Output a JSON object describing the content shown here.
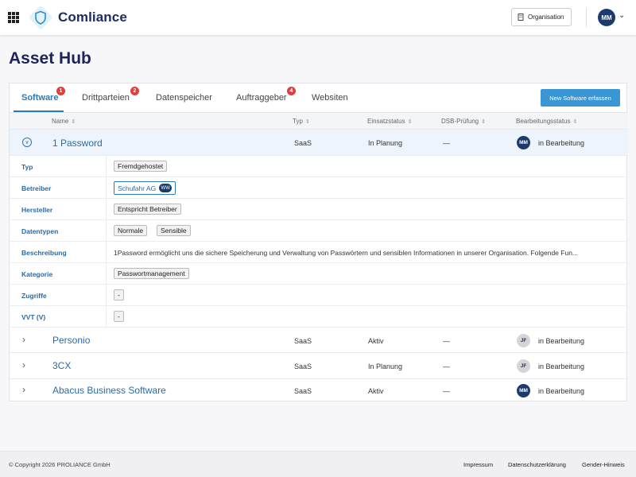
{
  "header": {
    "brand": "Comliance",
    "organisation_label": "Organisation",
    "user_initials": "MM",
    "icons": {
      "apps": "grid-icon",
      "logo": "shield-logo-icon",
      "org": "building-icon",
      "menu": "chevron-down-icon"
    }
  },
  "page": {
    "title": "Asset Hub"
  },
  "tabs": [
    {
      "label": "Software",
      "badge": "1",
      "active": true
    },
    {
      "label": "Drittparteien",
      "badge": "2"
    },
    {
      "label": "Datenspeicher",
      "badge": ""
    },
    {
      "label": "Auftraggeber",
      "badge": "4"
    },
    {
      "label": "Websiten",
      "badge": ""
    }
  ],
  "new_button": "New Software erfassen",
  "columns": [
    "Name",
    "Typ",
    "Einsatzstatus",
    "DSB-Prüfung",
    "Bearbeitungsstatus"
  ],
  "rows": [
    {
      "name": "1 Password",
      "typ": "SaaS",
      "einsatz": "In Planung",
      "dsb": "—",
      "avatar": "MM",
      "status": "in Bearbeitung",
      "expanded": true
    },
    {
      "name": "Personio",
      "typ": "SaaS",
      "einsatz": "Aktiv",
      "dsb": "—",
      "avatar": "JF",
      "status": "in Bearbeitung"
    },
    {
      "name": "3CX",
      "typ": "SaaS",
      "einsatz": "In Planung",
      "dsb": "—",
      "avatar": "JF",
      "status": "in Bearbeitung"
    },
    {
      "name": "Abacus Business Software",
      "typ": "SaaS",
      "einsatz": "Aktiv",
      "dsb": "—",
      "avatar": "MM",
      "status": "in Bearbeitung"
    }
  ],
  "details": {
    "typ": {
      "label": "Typ",
      "value": "Fremdgehostet"
    },
    "betreiber": {
      "label": "Betreiber",
      "value": "Schufahr AG",
      "avatar": "WW"
    },
    "hersteller": {
      "label": "Hersteller",
      "value": "Entspricht Betreiber"
    },
    "datentypen": {
      "label": "Datentypen",
      "values": [
        "Normale",
        "Sensible"
      ]
    },
    "beschreibung": {
      "label": "Beschreibung",
      "value": "1Password ermöglicht uns die sichere Speicherung und Verwaltung von Passwörtern und sensiblen Informationen in unserer Organisation. Folgende Fun..."
    },
    "kategorie": {
      "label": "Kategorie",
      "value": "Passwortmanagement"
    },
    "zugriffe": {
      "label": "Zugriffe",
      "value": "-"
    },
    "vvt": {
      "label": "VVT (V)",
      "value": "-"
    }
  },
  "footer": {
    "copyright": "© Copyright 2026 PROLIANCE GmbH",
    "links": [
      "Impressum",
      "Datenschutzerklärung",
      "Gender-Hinweis"
    ]
  },
  "colors": {
    "accent": "#3a96d5",
    "brand": "#1d2359",
    "badge": "#e0403d",
    "avatar_dark": "#1d3a6e"
  }
}
